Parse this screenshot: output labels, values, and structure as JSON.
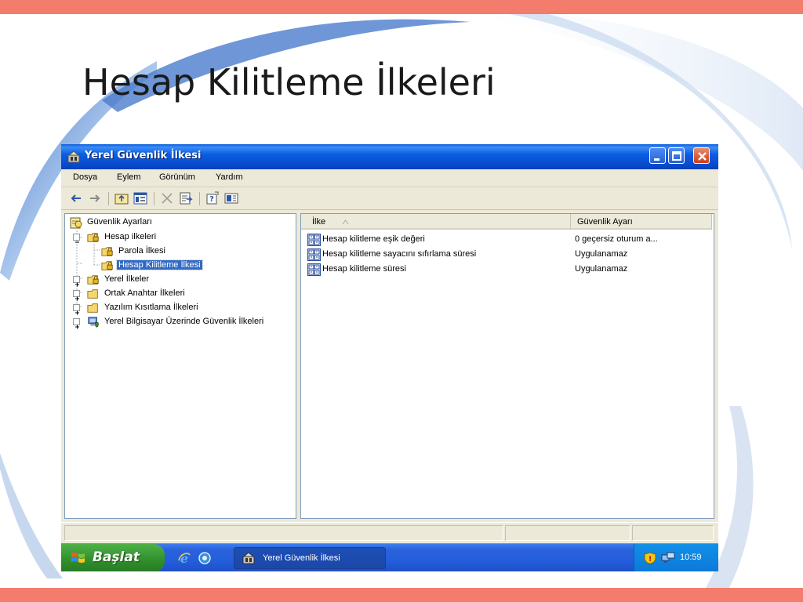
{
  "slide": {
    "title": "Hesap Kilitleme İlkeleri"
  },
  "window": {
    "title": "Yerel Güvenlik İlkesi",
    "menu": [
      "Dosya",
      "Eylem",
      "Görünüm",
      "Yardım"
    ]
  },
  "tree": {
    "root": "Güvenlik Ayarları",
    "account_policies": "Hesap ilkeleri",
    "password_policy": "Parola İlkesi",
    "lockout_policy": "Hesap Kilitleme İlkesi",
    "local_policies": "Yerel İlkeler",
    "public_key_policies": "Ortak Anahtar İlkeleri",
    "software_restriction": "Yazılım Kısıtlama İlkeleri",
    "ip_security": "Yerel Bilgisayar Üzerinde Güvenlik İlkeleri"
  },
  "list": {
    "columns": [
      "İlke",
      "Güvenlik Ayarı"
    ],
    "rows": [
      {
        "policy": "Hesap kilitleme eşik değeri",
        "setting": "0 geçersiz oturum a..."
      },
      {
        "policy": "Hesap kilitleme sayacını sıfırlama süresi",
        "setting": "Uygulanamaz"
      },
      {
        "policy": "Hesap kilitleme süresi",
        "setting": "Uygulanamaz"
      }
    ]
  },
  "taskbar": {
    "start_label": "Başlat",
    "task_label": "Yerel Güvenlik İlkesi",
    "clock": "10:59"
  }
}
